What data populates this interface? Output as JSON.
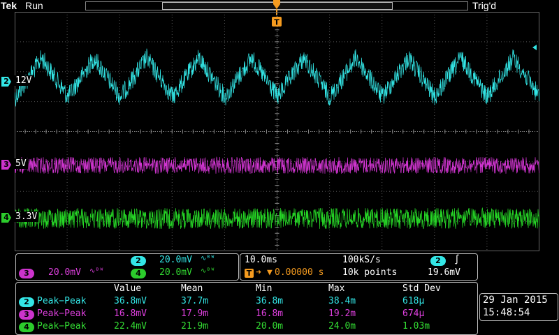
{
  "header": {
    "brand": "Tek",
    "run_state": "Run",
    "trigger_state": "Trig'd",
    "trigger_marker": "T"
  },
  "channels": [
    {
      "id": "2",
      "label": "12V",
      "color": "#33e6e6"
    },
    {
      "id": "3",
      "label": "5V",
      "color": "#e040e0"
    },
    {
      "id": "4",
      "label": "3.3V",
      "color": "#2ccc2c"
    }
  ],
  "vertical_settings": {
    "ch2": {
      "id": "2",
      "scale": "20.0mV",
      "coupling_icon": "∿ᴮᵂ"
    },
    "ch3": {
      "id": "3",
      "scale": "20.0mV",
      "coupling_icon": "∿ᴮᵂ"
    },
    "ch4": {
      "id": "4",
      "scale": "20.0mV",
      "coupling_icon": "∿ᴮᵂ"
    }
  },
  "horizontal": {
    "time_per_div": "10.0ms",
    "sample_rate": "100kS/s",
    "trigger_position": "0.00000 s",
    "record_length": "10k points",
    "trigger_source": "2",
    "trigger_slope_icon": "∫",
    "trigger_level": "19.6mV"
  },
  "measurements": {
    "headers": [
      "Value",
      "Mean",
      "Min",
      "Max",
      "Std Dev"
    ],
    "rows": [
      {
        "ch": "2",
        "type": "Peak−Peak",
        "value": "36.8mV",
        "mean": "37.7m",
        "min": "36.8m",
        "max": "38.4m",
        "std": "618µ"
      },
      {
        "ch": "3",
        "type": "Peak−Peak",
        "value": "16.8mV",
        "mean": "17.9m",
        "min": "16.8m",
        "max": "19.2m",
        "std": "674µ"
      },
      {
        "ch": "4",
        "type": "Peak−Peak",
        "value": "22.4mV",
        "mean": "21.9m",
        "min": "20.0m",
        "max": "24.0m",
        "std": "1.03m"
      }
    ]
  },
  "datetime": {
    "date": "29 Jan  2015",
    "time": "15:48:54"
  }
}
